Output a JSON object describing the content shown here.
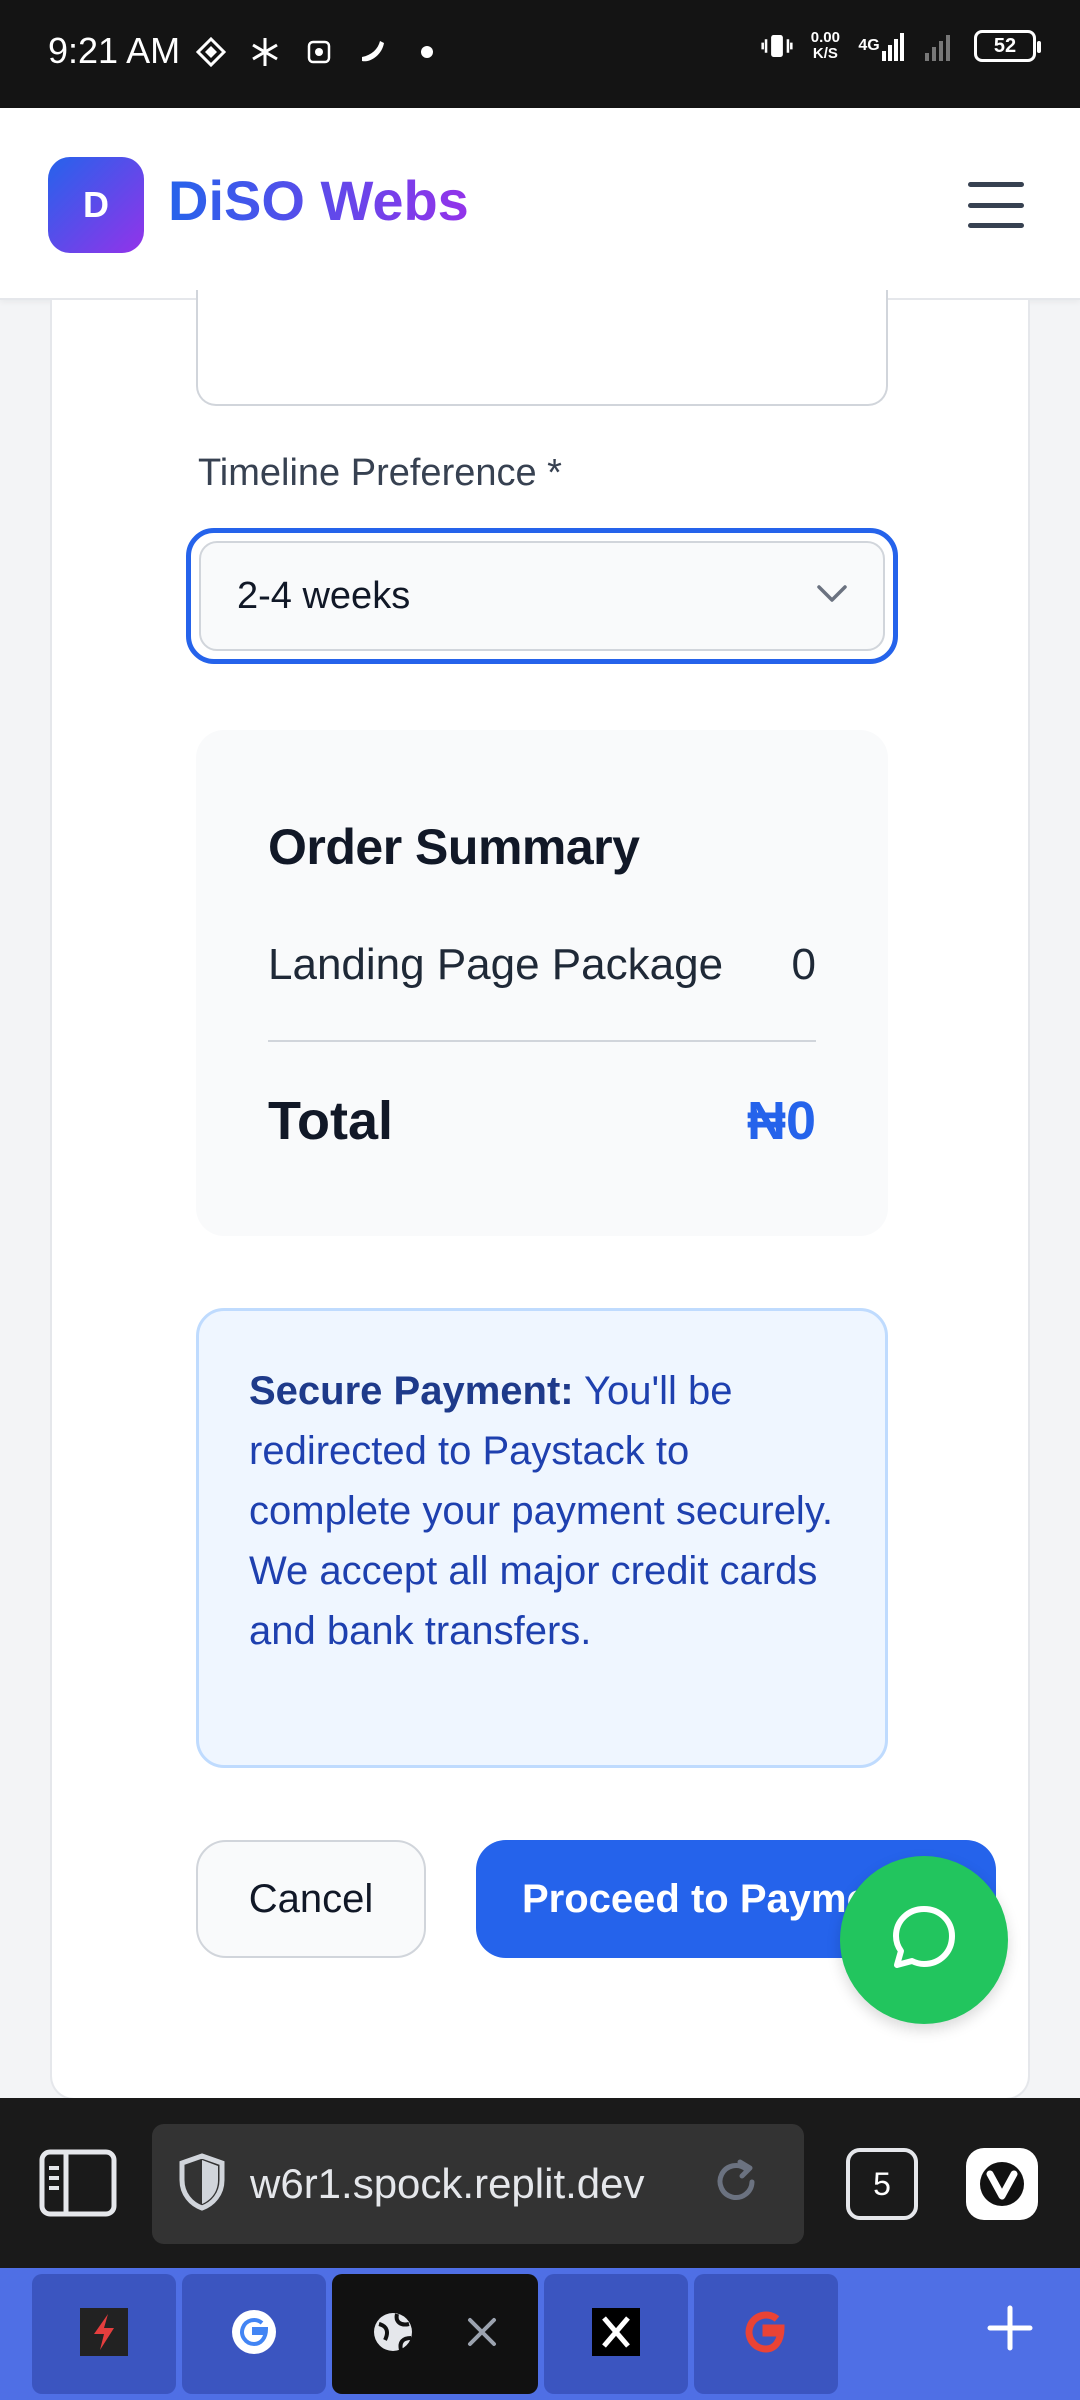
{
  "status_bar": {
    "time": "9:21 AM",
    "net_speed_value": "0.00",
    "net_speed_unit": "K/S",
    "network": "4G",
    "battery": "52"
  },
  "header": {
    "logo_letter": "D",
    "brand": "DiSO Webs"
  },
  "form": {
    "timeline_label": "Timeline Preference *",
    "timeline_value": "2-4 weeks"
  },
  "order_summary": {
    "title": "Order Summary",
    "item_name": "Landing Page Package",
    "item_price": "0",
    "total_label": "Total",
    "total_value": "₦0"
  },
  "notice": {
    "bold": "Secure Payment:",
    "text": " You'll be redirected to Paystack to complete your payment securely. We accept all major credit cards and bank transfers."
  },
  "actions": {
    "cancel": "Cancel",
    "proceed": "Proceed to Payment"
  },
  "browser": {
    "url": "w6r1.spock.replit.dev",
    "tab_count": "5"
  },
  "colors": {
    "primary": "#2563eb",
    "accent": "#9333ea",
    "whatsapp": "#22c55e",
    "tabstrip": "#4f6fe5"
  }
}
